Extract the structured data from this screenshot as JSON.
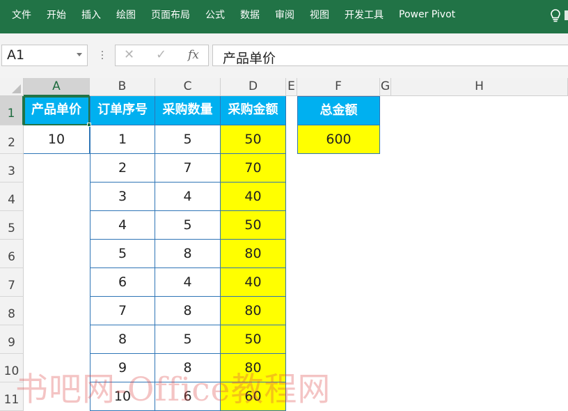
{
  "ribbon": {
    "tabs": [
      "文件",
      "开始",
      "插入",
      "绘图",
      "页面布局",
      "公式",
      "数据",
      "审阅",
      "视图",
      "开发工具",
      "Power Pivot"
    ],
    "color": "#217346"
  },
  "formula_bar": {
    "name_box": "A1",
    "content": "产品单价",
    "fx_label": "fx"
  },
  "sheet": {
    "columns": [
      "A",
      "B",
      "C",
      "D",
      "E",
      "F",
      "G",
      "H"
    ],
    "rows": [
      "1",
      "2",
      "3",
      "4",
      "5",
      "6",
      "7",
      "8",
      "9",
      "10",
      "11"
    ],
    "a1": "产品单价",
    "a2": "10",
    "headers": {
      "b": "订单序号",
      "c": "采购数量",
      "d": "采购金额",
      "f": "总金额"
    },
    "orders": [
      {
        "seq": "1",
        "qty": "5",
        "amount": "50"
      },
      {
        "seq": "2",
        "qty": "7",
        "amount": "70"
      },
      {
        "seq": "3",
        "qty": "4",
        "amount": "40"
      },
      {
        "seq": "4",
        "qty": "5",
        "amount": "50"
      },
      {
        "seq": "5",
        "qty": "8",
        "amount": "80"
      },
      {
        "seq": "6",
        "qty": "4",
        "amount": "40"
      },
      {
        "seq": "7",
        "qty": "8",
        "amount": "80"
      },
      {
        "seq": "8",
        "qty": "5",
        "amount": "50"
      },
      {
        "seq": "9",
        "qty": "8",
        "amount": "80"
      },
      {
        "seq": "10",
        "qty": "6",
        "amount": "60"
      }
    ],
    "total": "600",
    "header_color": "#00b0f0",
    "highlight_color": "#ffff00"
  },
  "watermark": "书吧网-Office教程网"
}
